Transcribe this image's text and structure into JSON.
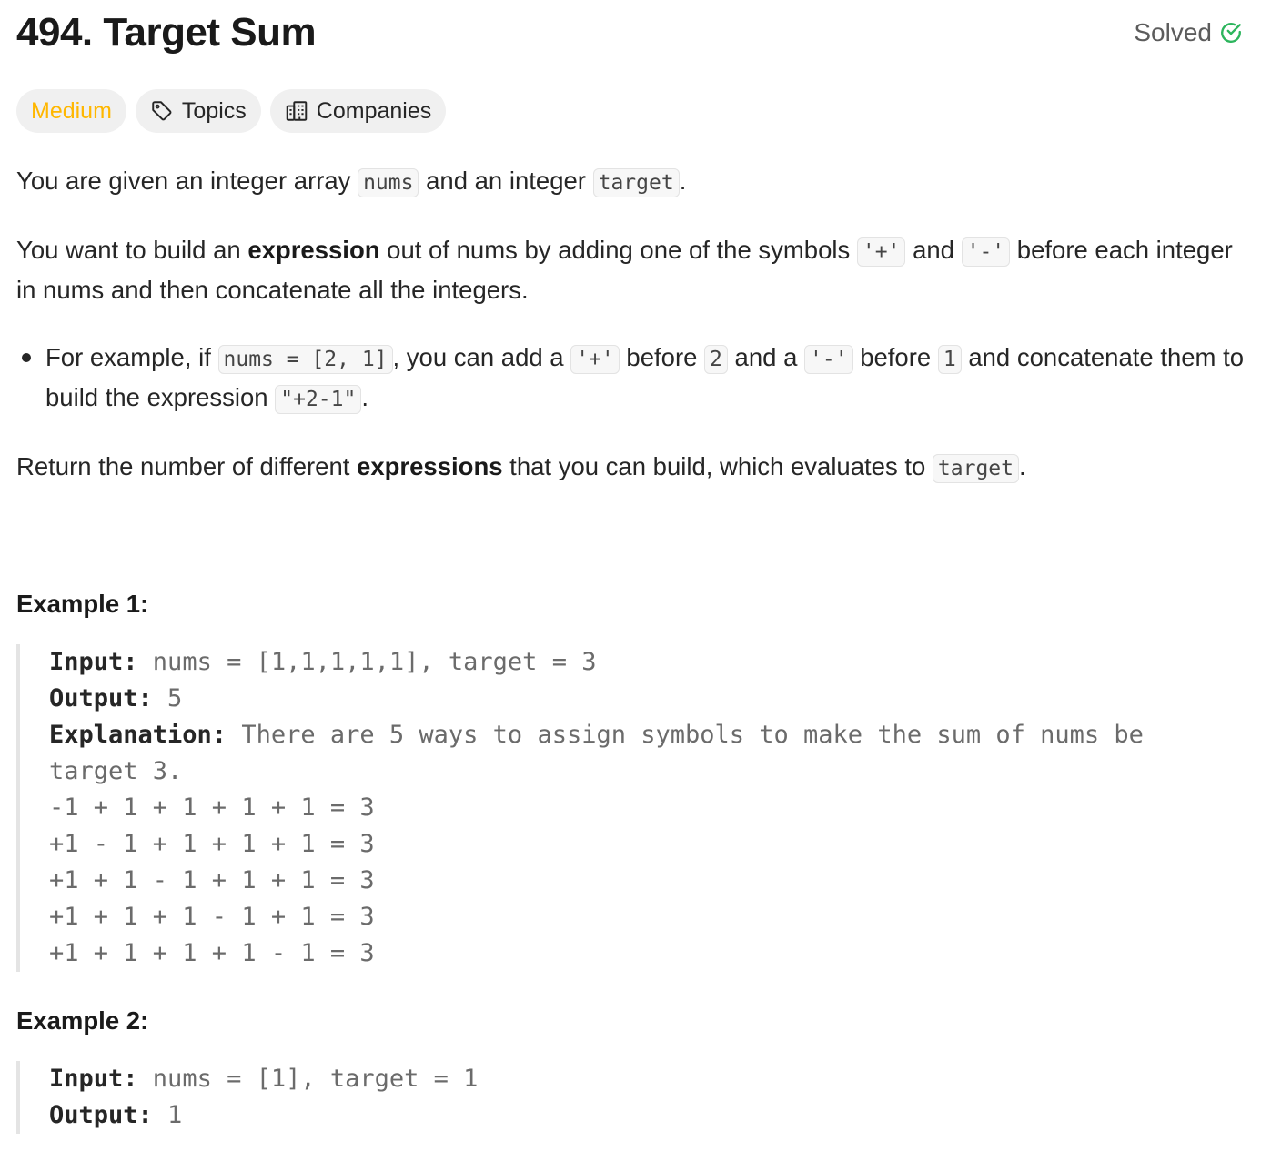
{
  "problem": {
    "title": "494. Target Sum",
    "status": "Solved"
  },
  "tags": {
    "difficulty": "Medium",
    "topics": "Topics",
    "companies": "Companies"
  },
  "description": {
    "p1": {
      "t1": "You are given an integer array ",
      "c1": "nums",
      "t2": " and an integer ",
      "c2": "target",
      "t3": "."
    },
    "p2": {
      "t1": "You want to build an ",
      "b1": "expression",
      "t2": " out of nums by adding one of the symbols ",
      "c1": "'+'",
      "t3": " and ",
      "c2": "'-'",
      "t4": " before each integer in nums and then concatenate all the integers."
    },
    "bullet": {
      "t1": "For example, if ",
      "c1": "nums = [2, 1]",
      "t2": ", you can add a ",
      "c2": "'+'",
      "t3": " before ",
      "c3": "2",
      "t4": " and a ",
      "c4": "'-'",
      "t5": " before ",
      "c5": "1",
      "t6": " and concatenate them to build the expression ",
      "c6": "\"+2-1\"",
      "t7": "."
    },
    "p3": {
      "t1": "Return the number of different ",
      "b1": "expressions",
      "t2": " that you can build, which evaluates to ",
      "c1": "target",
      "t3": "."
    }
  },
  "examples": [
    {
      "title": "Example 1:",
      "input_label": "Input:",
      "input": " nums = [1,1,1,1,1], target = 3",
      "output_label": "Output:",
      "output": " 5",
      "explanation_label": "Explanation:",
      "explanation": " There are 5 ways to assign symbols to make the sum of nums be target 3.",
      "lines": [
        "-1 + 1 + 1 + 1 + 1 = 3",
        "+1 - 1 + 1 + 1 + 1 = 3",
        "+1 + 1 - 1 + 1 + 1 = 3",
        "+1 + 1 + 1 - 1 + 1 = 3",
        "+1 + 1 + 1 + 1 - 1 = 3"
      ]
    },
    {
      "title": "Example 2:",
      "input_label": "Input:",
      "input": " nums = [1], target = 1",
      "output_label": "Output:",
      "output": " 1"
    }
  ],
  "colors": {
    "difficulty_medium": "#ffb700",
    "solved_check": "#2db55d",
    "tag_bg": "#f0f0f0",
    "code_bg": "#f7f7f7"
  },
  "icons": {
    "solved": "check-circle-icon",
    "topics": "tag-icon",
    "companies": "building-icon"
  }
}
